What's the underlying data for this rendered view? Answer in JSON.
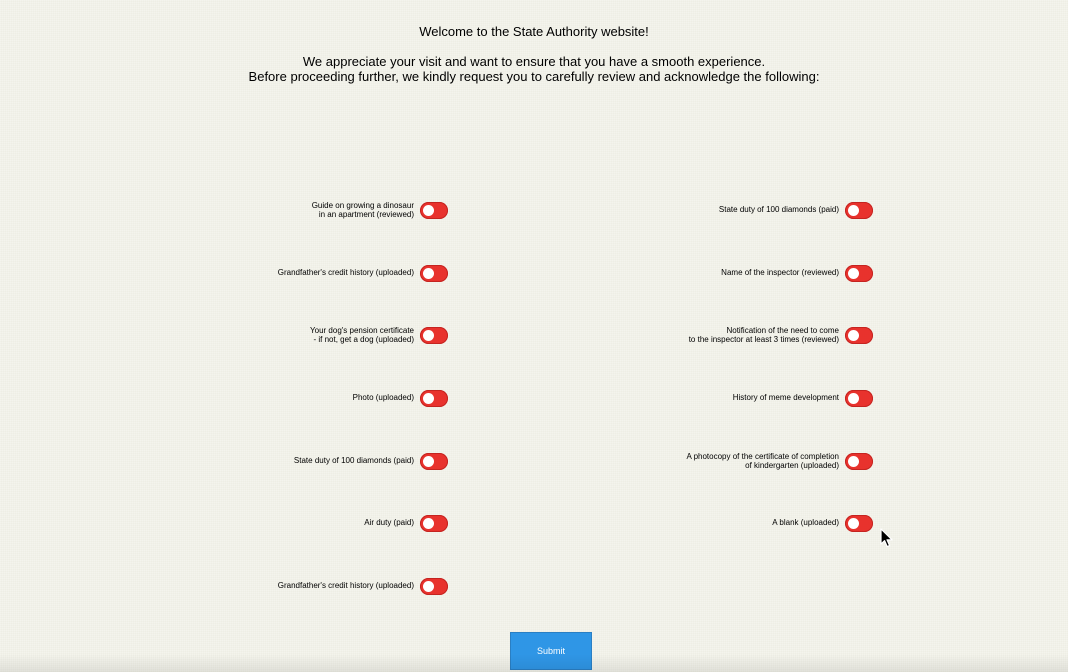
{
  "header": {
    "welcome": "Welcome to the State Authority website!",
    "line1": "We appreciate your visit and want to ensure that you have a smooth experience.",
    "line2": "Before proceeding further, we kindly request you to carefully review and acknowledge the following:"
  },
  "left_items": [
    {
      "line1": "Guide on growing a dinosaur",
      "line2": "in an apartment (reviewed)",
      "checked": false
    },
    {
      "line1": "Grandfather's credit history  (uploaded)",
      "line2": "",
      "checked": false
    },
    {
      "line1": "Your dog's pension certificate",
      "line2": "- if not, get a dog (uploaded)",
      "checked": false
    },
    {
      "line1": "Photo (uploaded)",
      "line2": "",
      "checked": false
    },
    {
      "line1": "State duty of 100 diamonds (paid)",
      "line2": "",
      "checked": false
    },
    {
      "line1": "Air duty (paid)",
      "line2": "",
      "checked": false
    },
    {
      "line1": "Grandfather's credit history  (uploaded)",
      "line2": "",
      "checked": false
    }
  ],
  "right_items": [
    {
      "line1": "State duty of 100 diamonds (paid)",
      "line2": "",
      "checked": false
    },
    {
      "line1": "Name of the inspector (reviewed)",
      "line2": "",
      "checked": false
    },
    {
      "line1": "Notification of the need to come",
      "line2": "to the inspector at least 3 times (reviewed)",
      "checked": false
    },
    {
      "line1": "History of meme development",
      "line2": "",
      "checked": false
    },
    {
      "line1": "A photocopy of the certificate of completion",
      "line2": "of kindergarten (uploaded)",
      "checked": false
    },
    {
      "line1": "A blank (uploaded)",
      "line2": "",
      "checked": false
    }
  ],
  "submit": {
    "label": "Submit"
  },
  "colors": {
    "toggle_off": "#e8322d",
    "button": "#2f96e6",
    "background": "#eeeee4"
  }
}
